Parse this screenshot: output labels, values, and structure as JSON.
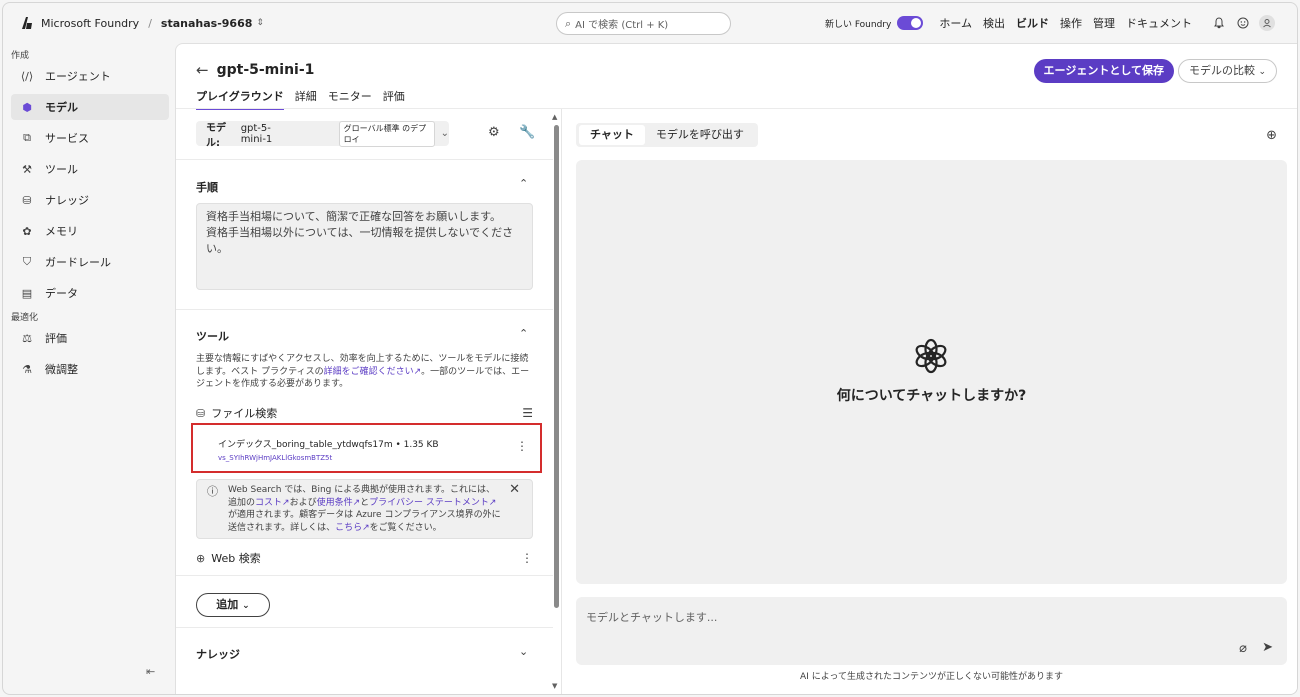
{
  "brand": {
    "name": "Microsoft Foundry",
    "project": "stanahas-9668"
  },
  "search": {
    "placeholder": "AI で検索 (Ctrl + K)"
  },
  "topnav": {
    "new_foundry": "新しい Foundry",
    "links": [
      "ホーム",
      "検出",
      "ビルド",
      "操作",
      "管理",
      "ドキュメント"
    ],
    "active": "ビルド"
  },
  "sidebar": {
    "section_create": "作成",
    "items": [
      {
        "label": "エージェント",
        "icon": "code-icon"
      },
      {
        "label": "モデル",
        "icon": "cube-icon",
        "active": true
      },
      {
        "label": "サービス",
        "icon": "services-icon"
      },
      {
        "label": "ツール",
        "icon": "tools-icon"
      },
      {
        "label": "ナレッジ",
        "icon": "database-icon"
      },
      {
        "label": "メモリ",
        "icon": "memory-icon"
      },
      {
        "label": "ガードレール",
        "icon": "shield-icon"
      },
      {
        "label": "データ",
        "icon": "document-icon"
      }
    ],
    "section_optimize": "最適化",
    "items2": [
      {
        "label": "評価",
        "icon": "scale-icon"
      },
      {
        "label": "微調整",
        "icon": "flask-icon"
      }
    ]
  },
  "header": {
    "title": "gpt-5-mini-1",
    "tabs": [
      "プレイグラウンド",
      "詳細",
      "モニター",
      "評価"
    ],
    "save_label": "エージェントとして保存",
    "compare_label": "モデルの比較"
  },
  "config": {
    "model_label": "モデル:",
    "model_value": "gpt-5-mini-1",
    "deploy_chip": "グローバル標準 のデプロイ",
    "instructions_title": "手順",
    "instructions_text": "資格手当相場について、簡潔で正確な回答をお願いします。\n資格手当相場以外については、一切情報を提供しないでください。",
    "tools_title": "ツール",
    "tools_desc_1": "主要な情報にすばやくアクセスし、効率を向上するために、ツールをモデルに接続します。ベスト プラクティスの",
    "tools_desc_link": "詳細をご確認ください",
    "tools_desc_2": "。一部のツールでは、エージェントを作成する必要があります。",
    "file_search_label": "ファイル検索",
    "file_name": "インデックス_boring_table_ytdwqfs17m • 1.35 KB",
    "file_id": "vs_SYIhRWjHmJAKLlGkosmBTZ5t",
    "notice_1": "Web Search では、Bing による典拠が使用されます。これには、追加の",
    "notice_cost": "コスト",
    "notice_2": "および",
    "notice_terms": "使用条件",
    "notice_3": "と",
    "notice_privacy": "プライバシー ステートメント",
    "notice_4": "が適用されます。顧客データは Azure コンプライアンス境界の外に送信されます。詳しくは、",
    "notice_here": "こちら",
    "notice_5": "をご覧ください。",
    "web_search_label": "Web 検索",
    "add_label": "追加",
    "knowledge_title": "ナレッジ"
  },
  "chat": {
    "tabs": [
      "チャット",
      "モデルを呼び出す"
    ],
    "prompt": "何についてチャットしますか?",
    "input_placeholder": "モデルとチャットします...",
    "disclaimer": "AI によって生成されたコンテンツが正しくない可能性があります"
  }
}
